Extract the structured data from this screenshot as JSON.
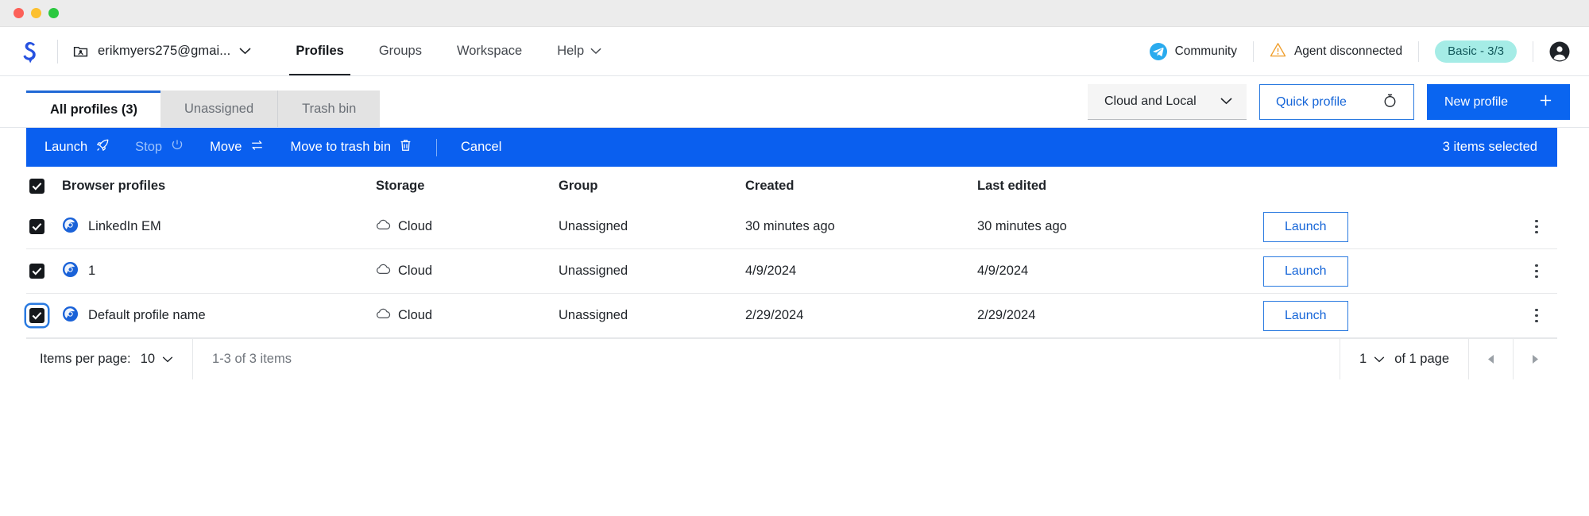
{
  "window": {
    "controls": [
      "close",
      "minimize",
      "maximize"
    ]
  },
  "header": {
    "logo_name": "gologin-logo",
    "account": {
      "icon": "folder-user-icon",
      "email": "erikmyers275@gmai...",
      "caret": "chevron-down-icon"
    },
    "nav": [
      {
        "label": "Profiles",
        "active": true,
        "caret": false
      },
      {
        "label": "Groups",
        "active": false,
        "caret": false
      },
      {
        "label": "Workspace",
        "active": false,
        "caret": false
      },
      {
        "label": "Help",
        "active": false,
        "caret": true
      }
    ],
    "community": {
      "icon": "telegram-icon",
      "label": "Community"
    },
    "agent_status": {
      "icon": "warning-triangle-icon",
      "label": "Agent disconnected",
      "color": "#f0a030"
    },
    "plan_badge": {
      "label": "Basic - 3/3",
      "bg": "#a5ece6",
      "fg": "#12595b"
    },
    "avatar": "user-avatar-icon"
  },
  "tabs": [
    {
      "label": "All profiles (3)",
      "active": true
    },
    {
      "label": "Unassigned",
      "active": false
    },
    {
      "label": "Trash bin",
      "active": false
    }
  ],
  "toolbar": {
    "scope_select": {
      "value": "Cloud and Local",
      "caret": "chevron-down-icon"
    },
    "quick_profile": {
      "label": "Quick profile",
      "icon": "stopwatch-icon"
    },
    "new_profile": {
      "label": "New profile",
      "icon": "plus-icon"
    }
  },
  "action_bar": {
    "bg": "#0a5fef",
    "items": [
      {
        "label": "Launch",
        "icon": "rocket-icon",
        "disabled": false
      },
      {
        "label": "Stop",
        "icon": "power-icon",
        "disabled": true
      },
      {
        "label": "Move",
        "icon": "transfer-icon",
        "disabled": false
      },
      {
        "label": "Move to trash bin",
        "icon": "trash-icon",
        "disabled": false
      },
      {
        "label": "Cancel",
        "icon": "",
        "disabled": false
      }
    ],
    "selection_text": "3 items selected"
  },
  "table": {
    "columns": [
      "Browser profiles",
      "Storage",
      "Group",
      "Created",
      "Last edited"
    ],
    "header_checkbox_checked": true,
    "rows": [
      {
        "checked": true,
        "focused": false,
        "icon": "browser-profile-icon",
        "name": "LinkedIn EM",
        "storage": "Cloud",
        "storage_icon": "cloud-icon",
        "group": "Unassigned",
        "created": "30 minutes ago",
        "last_edited": "30 minutes ago",
        "launch_label": "Launch"
      },
      {
        "checked": true,
        "focused": false,
        "icon": "browser-profile-icon",
        "name": "1",
        "storage": "Cloud",
        "storage_icon": "cloud-icon",
        "group": "Unassigned",
        "created": "4/9/2024",
        "last_edited": "4/9/2024",
        "launch_label": "Launch"
      },
      {
        "checked": true,
        "focused": true,
        "icon": "browser-profile-icon",
        "name": "Default profile name",
        "storage": "Cloud",
        "storage_icon": "cloud-icon",
        "group": "Unassigned",
        "created": "2/29/2024",
        "last_edited": "2/29/2024",
        "launch_label": "Launch"
      }
    ]
  },
  "footer": {
    "items_per_page_label": "Items per page:",
    "items_per_page_value": "10",
    "range_text": "1-3 of 3 items",
    "page_value": "1",
    "of_pages_text": "of 1 page",
    "prev_icon": "chevron-left-icon",
    "next_icon": "chevron-right-icon"
  }
}
